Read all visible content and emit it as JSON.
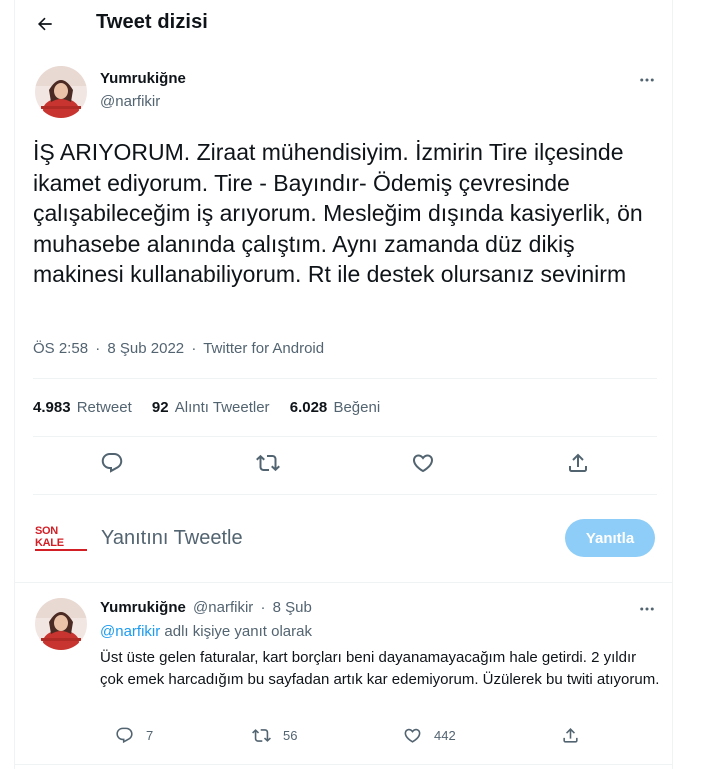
{
  "header": {
    "title": "Tweet dizisi"
  },
  "main_tweet": {
    "display_name": "Yumrukiğne",
    "handle": "@narfikir",
    "text": "İŞ ARIYORUM. Ziraat mühendisiyim. İzmirin Tire ilçesinde ikamet ediyorum. Tire - Bayındır- Ödemiş çevresinde çalışabileceğim iş arıyorum. Mesleğim dışında kasiyerlik, ön muhasebe alanında çalıştım. Aynı zamanda düz dikiş makinesi kullanabiliyorum. Rt ile destek olursanız sevinirm",
    "time": "ÖS 2:58",
    "date": "8 Şub 2022",
    "separator": "·",
    "source": "Twitter for Android",
    "stats": {
      "retweets_count": "4.983",
      "retweets_label": "Retweet",
      "quotes_count": "92",
      "quotes_label": "Alıntı Tweetler",
      "likes_count": "6.028",
      "likes_label": "Beğeni"
    }
  },
  "composer": {
    "logo_text": "SON KALE",
    "placeholder": "Yanıtını Tweetle",
    "reply_button": "Yanıtla"
  },
  "reply_tweet": {
    "display_name": "Yumrukiğne",
    "handle": "@narfikir",
    "separator": "·",
    "date": "8 Şub",
    "replying_mention": "@narfikir",
    "replying_suffix": "adlı kişiye yanıt olarak",
    "text": "Üst üste gelen faturalar, kart borçları beni dayanamayacağım hale getirdi. 2 yıldır çok emek harcadığım bu sayfadan artık kar edemiyorum. Üzülerek bu twiti atıyorum.",
    "replies": "7",
    "retweets": "56",
    "likes": "442"
  },
  "colors": {
    "accent": "#1d9bf0",
    "reply_button_disabled": "#8ecdf8",
    "secondary_text": "#536471",
    "divider": "#eff3f4",
    "logo_red": "#d21f26"
  },
  "icons": [
    "back-arrow-icon",
    "more-icon",
    "reply-icon",
    "retweet-icon",
    "like-icon",
    "share-icon"
  ]
}
